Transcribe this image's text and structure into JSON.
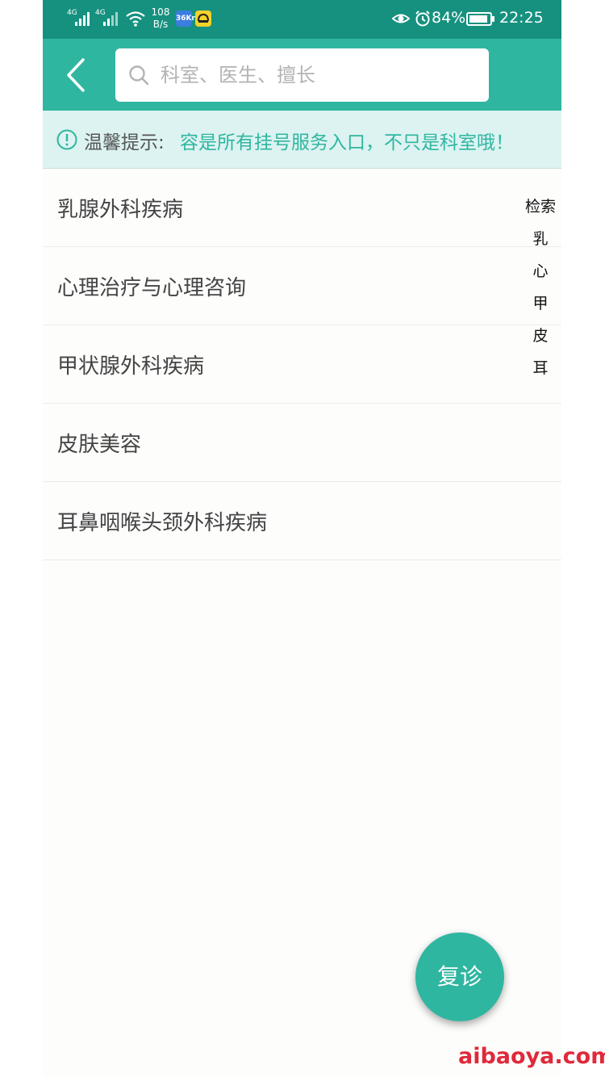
{
  "status_bar": {
    "network_1": "4G",
    "network_2": "4G",
    "net_speed_value": "108",
    "net_speed_unit": "B/s",
    "app_icon_1_text": "36Kr",
    "battery_percent": "84%",
    "time": "22:25"
  },
  "header": {
    "search_placeholder": "科室、医生、擅长"
  },
  "tip": {
    "label": "温馨提示:",
    "text": "容是所有挂号服务入口，不只是科室哦！"
  },
  "departments": [
    "乳腺外科疾病",
    "心理治疗与心理咨询",
    "甲状腺外科疾病",
    "皮肤美容",
    "耳鼻咽喉头颈外科疾病"
  ],
  "index_bar": [
    "检索",
    "乳",
    "心",
    "甲",
    "皮",
    "耳"
  ],
  "fab": {
    "label": "复诊"
  },
  "watermark": "aibaoya.com",
  "colors": {
    "status_bar": "#16917f",
    "header": "#2fb6a0",
    "tip_background": "#dcf3f1",
    "accent": "#2fb6a0",
    "watermark": "#e0293b"
  },
  "icons": {
    "back": "chevron-left-icon",
    "search": "search-icon",
    "tip": "exclamation-circle-icon",
    "eye": "eye-icon",
    "alarm": "alarm-clock-icon",
    "battery": "battery-icon",
    "wifi": "wifi-icon",
    "signal": "signal-icon"
  }
}
